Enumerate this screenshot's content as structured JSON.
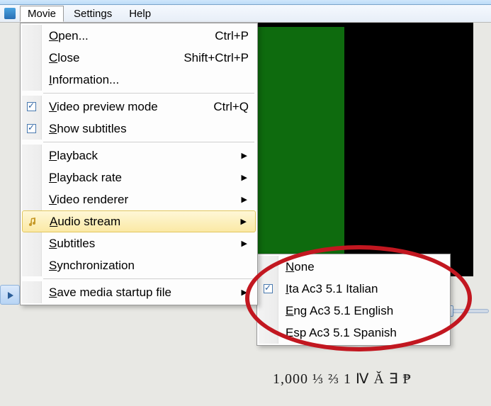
{
  "menubar": {
    "movie": "Movie",
    "settings": "Settings",
    "help": "Help"
  },
  "menu": {
    "open": {
      "label": "Open...",
      "u": "O",
      "shortcut": "Ctrl+P"
    },
    "close": {
      "label": "Close",
      "u": "C",
      "shortcut": "Shift+Ctrl+P"
    },
    "information": {
      "label": "Information...",
      "u": "I"
    },
    "video_preview": {
      "label": "Video preview mode",
      "u": "V",
      "shortcut": "Ctrl+Q",
      "checked": true
    },
    "show_subtitles": {
      "label": "Show subtitles",
      "u": "S",
      "checked": true
    },
    "playback": {
      "label": "Playback",
      "u": "P"
    },
    "playback_rate": {
      "label": "Playback rate",
      "u": "P"
    },
    "video_renderer": {
      "label": "Video renderer",
      "u": "V"
    },
    "audio_stream": {
      "label": "Audio stream",
      "u": "A"
    },
    "subtitles": {
      "label": "Subtitles",
      "u": "S"
    },
    "synchronization": {
      "label": "Synchronization",
      "u": "S"
    },
    "save_media": {
      "label": "Save media startup file",
      "u": "S"
    }
  },
  "audio_submenu": {
    "none": {
      "label": "None",
      "u": "N"
    },
    "ita": {
      "label": "Ita Ac3 5.1 Italian",
      "u": "I",
      "checked": true
    },
    "eng": {
      "label": "Eng Ac3 5.1 English",
      "u": "E"
    },
    "esp": {
      "label": "Esp Ac3 5.1 Spanish",
      "u": "E"
    }
  },
  "bottom_sample": "1,000  ⅓ ⅔ 1 Ⅳ Ǎ ∃ ₱"
}
